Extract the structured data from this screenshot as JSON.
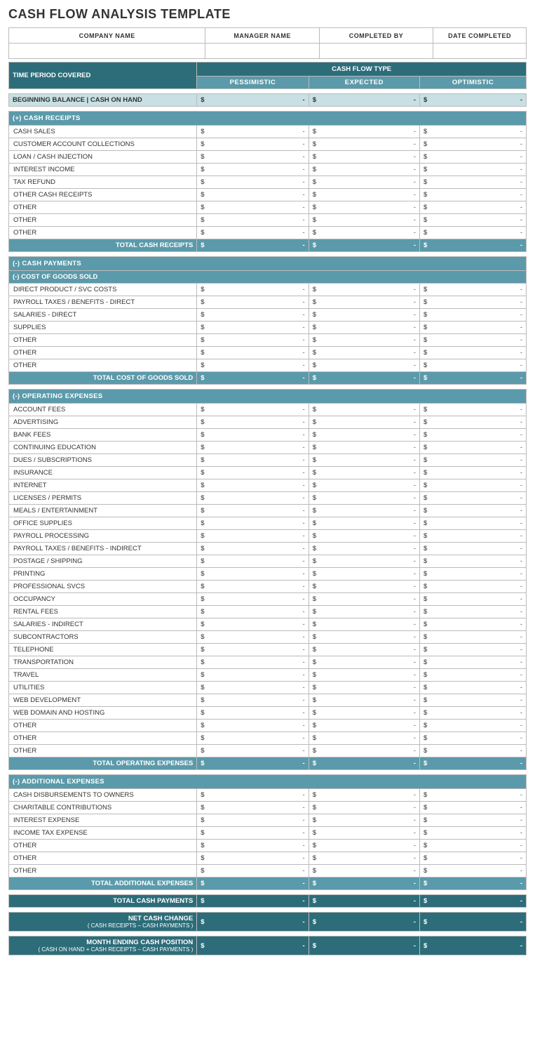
{
  "title": "CASH FLOW ANALYSIS TEMPLATE",
  "header": {
    "col1": "COMPANY NAME",
    "col2": "MANAGER NAME",
    "col3": "COMPLETED BY",
    "col4": "DATE COMPLETED"
  },
  "time_period": "TIME PERIOD COVERED",
  "cash_flow_type": "CASH FLOW TYPE",
  "pessimistic": "PESSIMISTIC",
  "expected": "EXPECTED",
  "optimistic": "OPTIMISTIC",
  "beginning_balance": "BEGINNING BALANCE | CASH ON HAND",
  "cash_receipts_header": "(+)  CASH RECEIPTS",
  "cash_receipts_items": [
    "CASH SALES",
    "CUSTOMER ACCOUNT COLLECTIONS",
    "LOAN / CASH INJECTION",
    "INTEREST INCOME",
    "TAX REFUND",
    "OTHER CASH RECEIPTS",
    "OTHER",
    "OTHER",
    "OTHER"
  ],
  "total_cash_receipts": "TOTAL CASH RECEIPTS",
  "cash_payments_header": "(-) CASH PAYMENTS",
  "cost_of_goods_header": "(-) COST OF GOODS SOLD",
  "cost_of_goods_items": [
    "DIRECT PRODUCT / SVC COSTS",
    "PAYROLL TAXES / BENEFITS - DIRECT",
    "SALARIES - DIRECT",
    "SUPPLIES",
    "OTHER",
    "OTHER",
    "OTHER"
  ],
  "total_cost_goods": "TOTAL COST OF GOODS SOLD",
  "operating_expenses_header": "(-) OPERATING EXPENSES",
  "operating_expenses_items": [
    "ACCOUNT FEES",
    "ADVERTISING",
    "BANK FEES",
    "CONTINUING EDUCATION",
    "DUES / SUBSCRIPTIONS",
    "INSURANCE",
    "INTERNET",
    "LICENSES / PERMITS",
    "MEALS / ENTERTAINMENT",
    "OFFICE SUPPLIES",
    "PAYROLL PROCESSING",
    "PAYROLL TAXES / BENEFITS - INDIRECT",
    "POSTAGE / SHIPPING",
    "PRINTING",
    "PROFESSIONAL SVCS",
    "OCCUPANCY",
    "RENTAL FEES",
    "SALARIES - INDIRECT",
    "SUBCONTRACTORS",
    "TELEPHONE",
    "TRANSPORTATION",
    "TRAVEL",
    "UTILITIES",
    "WEB DEVELOPMENT",
    "WEB DOMAIN AND HOSTING",
    "OTHER",
    "OTHER",
    "OTHER"
  ],
  "total_operating_expenses": "TOTAL OPERATING EXPENSES",
  "additional_expenses_header": "(-) ADDITIONAL EXPENSES",
  "additional_expenses_items": [
    "CASH DISBURSEMENTS TO OWNERS",
    "CHARITABLE CONTRIBUTIONS",
    "INTEREST EXPENSE",
    "INCOME TAX EXPENSE",
    "OTHER",
    "OTHER",
    "OTHER"
  ],
  "total_additional_expenses": "TOTAL ADDITIONAL EXPENSES",
  "total_cash_payments": "TOTAL CASH PAYMENTS",
  "net_cash_change": "NET CASH CHANGE",
  "net_cash_subtitle": "( CASH RECEIPTS – CASH PAYMENTS )",
  "month_ending": "MONTH ENDING CASH POSITION",
  "month_ending_subtitle": "( CASH ON HAND + CASH RECEIPTS – CASH PAYMENTS )",
  "dollar": "$",
  "dash": "-"
}
